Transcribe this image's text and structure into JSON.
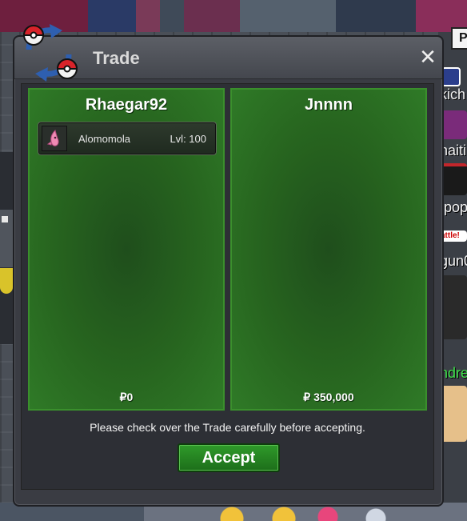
{
  "window": {
    "title": "Trade",
    "close_glyph": "✕"
  },
  "icons": {
    "trade_logo": "trade-pokeball-arrows-icon",
    "close": "close-icon",
    "item": "pokemon-sprite-icon"
  },
  "left_panel": {
    "player_name": "Rhaegar92",
    "items": [
      {
        "name": "Alomomola",
        "level": "Lvl: 100"
      }
    ],
    "money": "₽0"
  },
  "right_panel": {
    "player_name": "Jnnnn",
    "items": [],
    "money": "₽ 350,000"
  },
  "notice": "Please check over the Trade carefully before accepting.",
  "accept_label": "Accept",
  "background": {
    "side_labels": [
      "kich",
      "naiti",
      ".pop",
      "gun0",
      "ndre"
    ],
    "side_box": "P",
    "battle_tag": "attle!"
  },
  "colors": {
    "panel_green": "#27651f",
    "accept_green": "#2f9a2a",
    "window_bg": "#3a3c43"
  }
}
